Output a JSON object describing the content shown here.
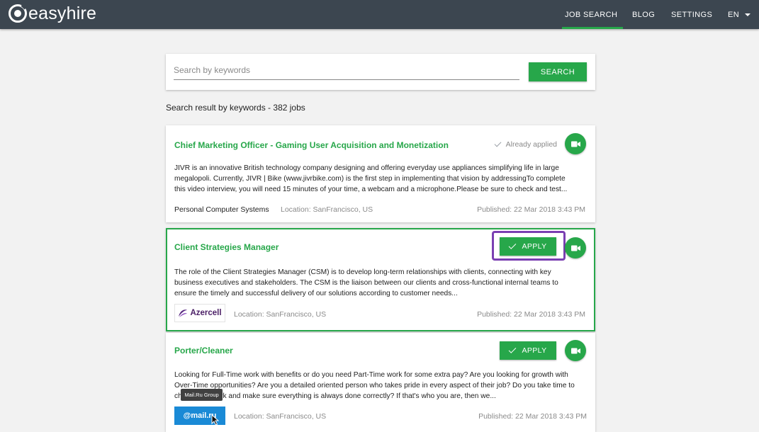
{
  "header": {
    "brand": "easyhire",
    "nav": [
      {
        "label": "JOB SEARCH",
        "active": true
      },
      {
        "label": "BLOG",
        "active": false
      },
      {
        "label": "SETTINGS",
        "active": false
      },
      {
        "label": "EN",
        "active": false
      }
    ]
  },
  "search": {
    "placeholder": "Search by keywords",
    "value": "",
    "button_label": "SEARCH"
  },
  "results": {
    "summary": "Search result by keywords - 382 jobs"
  },
  "jobs": [
    {
      "title": "Chief Marketing Officer - Gaming User Acquisition and Monetization",
      "status": "Already applied",
      "description": "JIVR is an innovative British technology company designing and offering everyday use appliances simplifying life in large megalopoli. Currently, JIVR | Bike (www.jivrbike.com) is the first step in implementing that vision by addressingTo complete this video interview, you will need 15 minutes of your time, a webcam and a microphone.Please be sure to check and test...",
      "company": "Personal Computer Systems",
      "location": "Location: SanFrancisco, US",
      "published": "Published: 22 Mar 2018 3:43 PM"
    },
    {
      "title": "Client Strategies Manager",
      "apply_label": "APPLY",
      "description": "The role of the Client Strategies Manager (CSM) is to develop long-term relationships with clients, connecting with key business executives and stakeholders.  The CSM is the liaison between our clients and cross-functional internal teams to ensure the timely and successful delivery of our solutions according to customer needs...",
      "company_logo": "Azercell",
      "location": "Location: SanFrancisco, US",
      "published": "Published: 22 Mar 2018 3:43 PM"
    },
    {
      "title": "Porter/Cleaner",
      "apply_label": "APPLY",
      "description": "Looking for Full-Time work with benefits or do you need Part-Time work for some extra pay? Are you looking for growth with Over-Time opportunities? Are you a detailed oriented person who takes pride in every aspect of their job?  Do you take time to check your work and make sure everything is always done correctly?  If that's who you are, then we...",
      "company_logo": "@mail.ru",
      "location": "Location: SanFrancisco, US",
      "published": "Published: 22 Mar 2018 3:43 PM",
      "tooltip": "Mail.Ru Group"
    }
  ],
  "colors": {
    "accent": "#27a74a",
    "header_bg": "#3c4650",
    "highlight": "#7a3fb2"
  }
}
